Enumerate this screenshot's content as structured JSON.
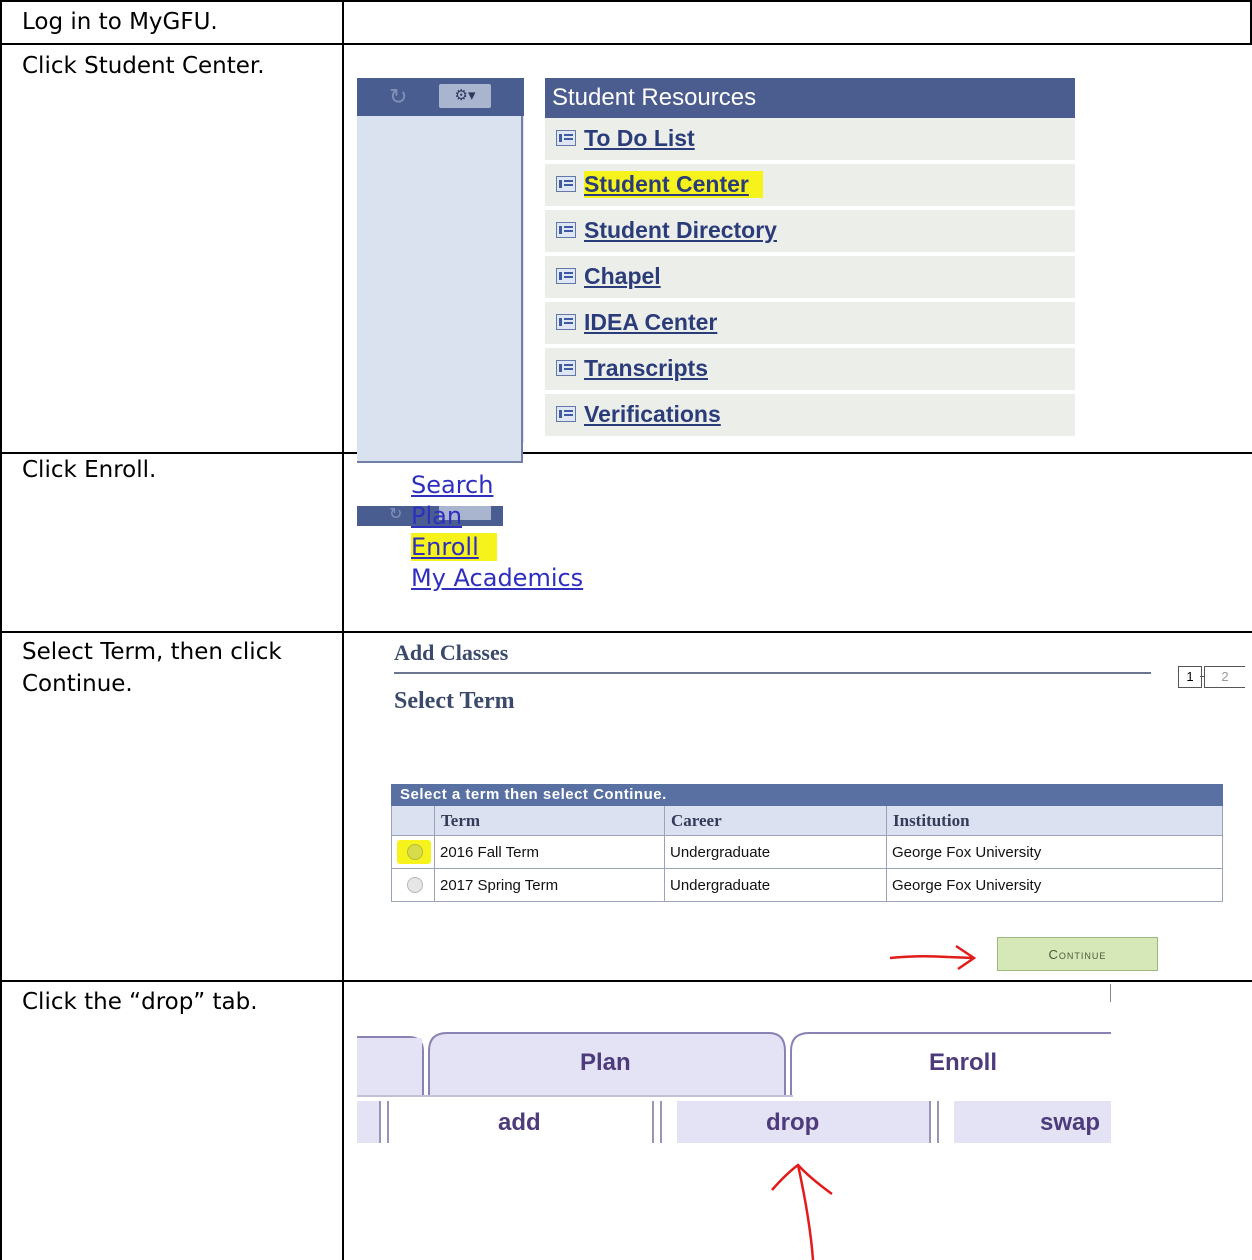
{
  "steps": [
    {
      "text": "Log in to MyGFU."
    },
    {
      "text": "Click Student Center."
    },
    {
      "text": "Click Enroll."
    },
    {
      "text": "Select Term, then click Continue."
    },
    {
      "text": "Click the “drop” tab."
    }
  ],
  "portal": {
    "header": "Student Resources",
    "links": [
      "To Do List",
      "Student Center",
      "Student Directory",
      "Chapel",
      "IDEA Center",
      "Transcripts",
      "Verifications"
    ],
    "highlighted": "Student Center",
    "highlight_color": "#f6f21b"
  },
  "student_links": {
    "items": [
      "Search",
      "Plan",
      "Enroll",
      "My Academics"
    ],
    "highlighted": "Enroll"
  },
  "add_classes": {
    "title": "Add Classes",
    "subtitle": "Select Term",
    "steps": [
      "1",
      "2"
    ],
    "table_caption": "Select a term then select Continue.",
    "columns": [
      "Term",
      "Career",
      "Institution"
    ],
    "rows": [
      {
        "term": "2016 Fall Term",
        "career": "Undergraduate",
        "institution": "George Fox University",
        "selected": true
      },
      {
        "term": "2017 Spring Term",
        "career": "Undergraduate",
        "institution": "George Fox University",
        "selected": false
      }
    ],
    "continue_label": "Continue"
  },
  "tabs": {
    "top": [
      "Plan",
      "Enroll"
    ],
    "sub": [
      "add",
      "drop",
      "swap"
    ]
  }
}
